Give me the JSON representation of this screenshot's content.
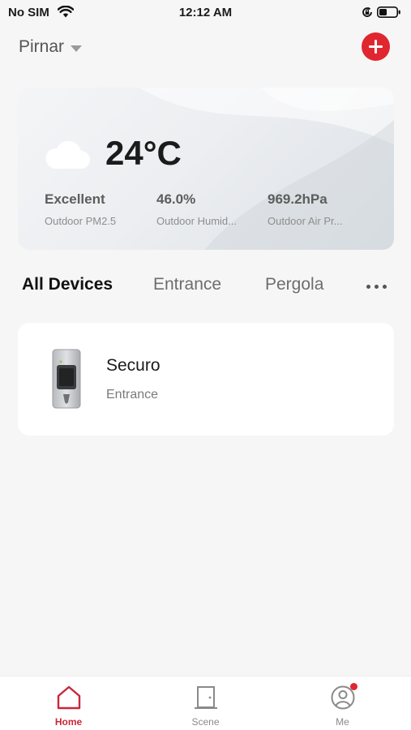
{
  "status_bar": {
    "carrier": "No SIM",
    "time": "12:12 AM"
  },
  "header": {
    "home_name": "Pirnar"
  },
  "weather": {
    "temperature": "24°C",
    "metrics": [
      {
        "value": "Excellent",
        "label": "Outdoor PM2.5"
      },
      {
        "value": "46.0%",
        "label": "Outdoor Humid..."
      },
      {
        "value": "969.2hPa",
        "label": "Outdoor Air Pr..."
      }
    ]
  },
  "tabs": [
    "All Devices",
    "Entrance",
    "Pergola"
  ],
  "active_tab": "All Devices",
  "devices": [
    {
      "name": "Securo",
      "room": "Entrance"
    }
  ],
  "bottom_nav": [
    {
      "label": "Home",
      "icon": "home-icon",
      "active": true
    },
    {
      "label": "Scene",
      "icon": "door-icon",
      "active": false
    },
    {
      "label": "Me",
      "icon": "user-icon",
      "active": false,
      "badge": true
    }
  ],
  "colors": {
    "accent": "#e0262f",
    "active_nav": "#c9283a",
    "background": "#f6f6f7"
  }
}
